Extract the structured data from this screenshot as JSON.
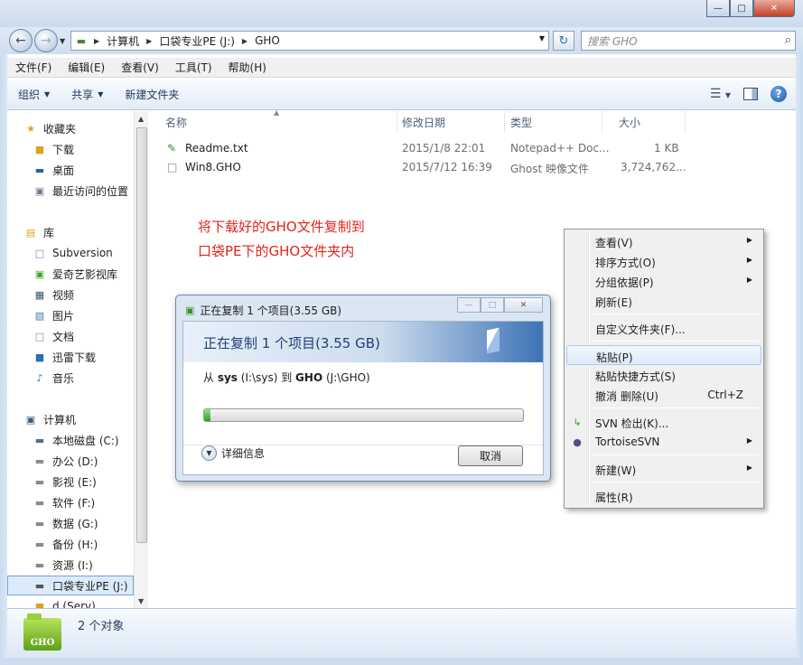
{
  "address": {
    "crumbs": [
      "计算机",
      "口袋专业PE (J:)",
      "GHO"
    ],
    "search_placeholder": "搜索 GHO"
  },
  "menubar": [
    "文件(F)",
    "编辑(E)",
    "查看(V)",
    "工具(T)",
    "帮助(H)"
  ],
  "toolbar": {
    "organize": "组织",
    "share": "共享",
    "new_folder": "新建文件夹"
  },
  "nav": {
    "favorites": {
      "label": "收藏夹",
      "items": [
        "下载",
        "桌面",
        "最近访问的位置"
      ]
    },
    "libraries": {
      "label": "库",
      "items": [
        "Subversion",
        "爱奇艺影视库",
        "视频",
        "图片",
        "文档",
        "迅雷下载",
        "音乐"
      ]
    },
    "computer": {
      "label": "计算机",
      "items": [
        "本地磁盘 (C:)",
        "办公 (D:)",
        "影视 (E:)",
        "软件 (F:)",
        "数据 (G:)",
        "备份 (H:)",
        "资源 (I:)",
        "口袋专业PE (J:)",
        "d (Serv)"
      ]
    }
  },
  "columns": {
    "name": "名称",
    "date": "修改日期",
    "type": "类型",
    "size": "大小"
  },
  "files": [
    {
      "name": "Readme.txt",
      "date": "2015/1/8 22:01",
      "type": "Notepad++ Doc...",
      "size": "1 KB"
    },
    {
      "name": "Win8.GHO",
      "date": "2015/7/12 16:39",
      "type": "Ghost 映像文件",
      "size": "3,724,762..."
    }
  ],
  "annotation": {
    "line1": "将下载好的GHO文件复制到",
    "line2": "口袋PE下的GHO文件夹内"
  },
  "copy_dialog": {
    "title": "正在复制 1 个项目(3.55 GB)",
    "heading": "正在复制 1 个项目(3.55 GB)",
    "from_label": "从",
    "src_name": "sys",
    "src_path": "(I:\\sys)",
    "to_label": "到",
    "dst_name": "GHO",
    "dst_path": "(J:\\GHO)",
    "progress_percent": 2,
    "details_label": "详细信息",
    "cancel_label": "取消"
  },
  "context_menu": {
    "view": "查看(V)",
    "sort": "排序方式(O)",
    "group": "分组依据(P)",
    "refresh": "刷新(E)",
    "customize": "自定义文件夹(F)...",
    "paste": "粘贴(P)",
    "paste_shortcut": "粘贴快捷方式(S)",
    "undo": "撤消 删除(U)",
    "undo_shortcut": "Ctrl+Z",
    "svn_checkout": "SVN 检出(K)...",
    "tortoise": "TortoiseSVN",
    "new": "新建(W)",
    "properties": "属性(R)"
  },
  "status": {
    "count": "2 个对象",
    "icon_text": "GHO"
  },
  "colors": {
    "annotation": "#e0241b",
    "progress": "#22a51d",
    "selection": "#dcebfc"
  }
}
